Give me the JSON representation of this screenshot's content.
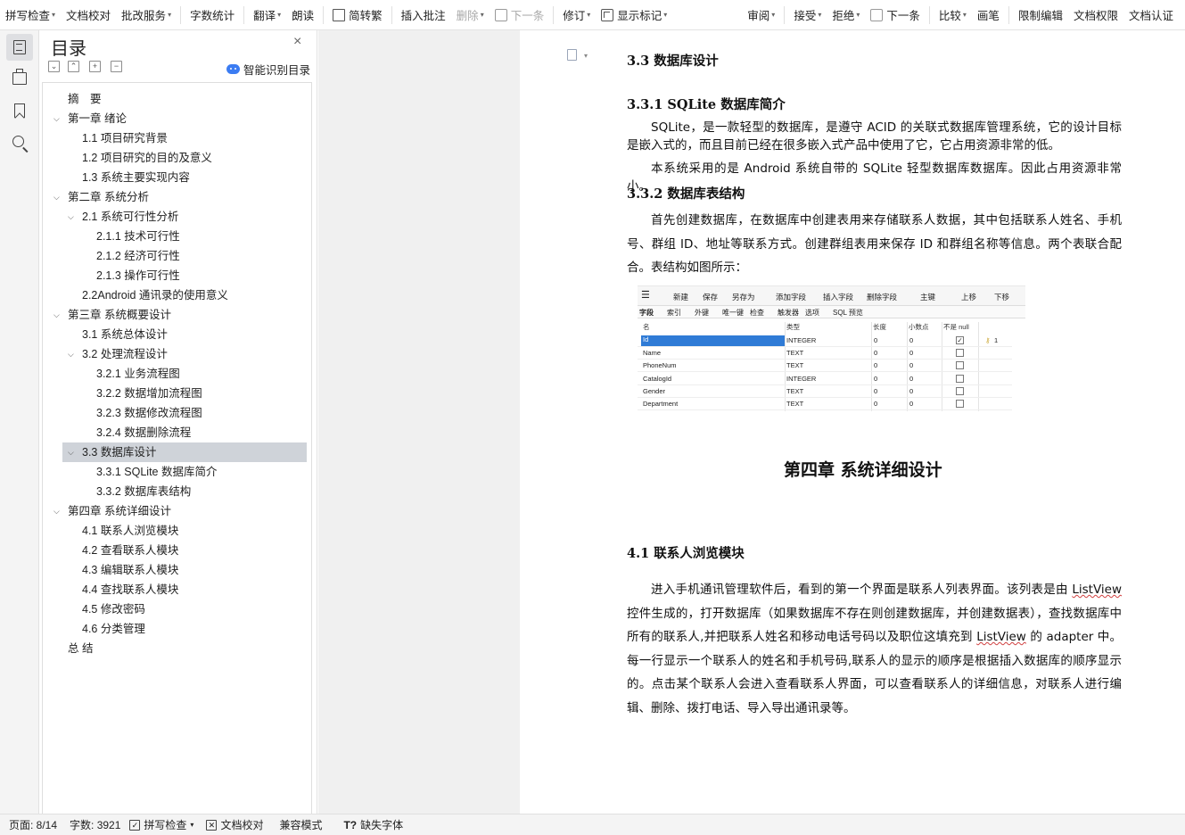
{
  "toolbar": {
    "items": [
      {
        "label": "拼写检查",
        "caret": true
      },
      {
        "label": "文档校对"
      },
      {
        "label": "批改服务",
        "caret": true
      },
      {
        "label": "字数统计"
      },
      {
        "label": "翻译",
        "caret": true
      },
      {
        "label": "朗读"
      },
      {
        "label": "简转繁"
      },
      {
        "label": "插入批注"
      },
      {
        "label": "删除",
        "caret": true,
        "disabled": true
      },
      {
        "label": "下一条",
        "disabled": true
      },
      {
        "label": "修订",
        "caret": true
      },
      {
        "label": "显示标记",
        "caret": true
      },
      {
        "label": "审阅",
        "caret": true
      },
      {
        "label": "接受",
        "caret": true
      },
      {
        "label": "拒绝",
        "caret": true
      },
      {
        "label": "下一条"
      },
      {
        "label": "比较",
        "caret": true
      },
      {
        "label": "画笔"
      },
      {
        "label": "限制编辑"
      },
      {
        "label": "文档权限"
      },
      {
        "label": "文档认证"
      }
    ]
  },
  "rail": {
    "buttons": [
      "toc-icon",
      "navigation-tree-icon",
      "bookmark-icon",
      "search-icon"
    ]
  },
  "toc": {
    "title": "目录",
    "close": "×",
    "controls": [
      "⌄",
      "⌃",
      "+",
      "−"
    ],
    "smart_label": "智能识别目录",
    "items": [
      {
        "text": "摘　要",
        "level": 0,
        "toggle": ""
      },
      {
        "text": "第一章  绪论",
        "level": 0,
        "toggle": "v"
      },
      {
        "text": "1.1 项目研究背景",
        "level": 1,
        "toggle": ""
      },
      {
        "text": "1.2 项目研究的目的及意义",
        "level": 1,
        "toggle": ""
      },
      {
        "text": "1.3 系统主要实现内容",
        "level": 1,
        "toggle": ""
      },
      {
        "text": "第二章  系统分析",
        "level": 0,
        "toggle": "v"
      },
      {
        "text": "2.1 系统可行性分析",
        "level": 1,
        "toggle": "v"
      },
      {
        "text": "2.1.1 技术可行性",
        "level": 2,
        "toggle": ""
      },
      {
        "text": "2.1.2 经济可行性",
        "level": 2,
        "toggle": ""
      },
      {
        "text": "2.1.3 操作可行性",
        "level": 2,
        "toggle": ""
      },
      {
        "text": "2.2Android 通讯录的使用意义",
        "level": 1,
        "toggle": ""
      },
      {
        "text": "第三章  系统概要设计",
        "level": 0,
        "toggle": "v"
      },
      {
        "text": "3.1 系统总体设计",
        "level": 1,
        "toggle": ""
      },
      {
        "text": "3.2 处理流程设计",
        "level": 1,
        "toggle": "v"
      },
      {
        "text": "3.2.1 业务流程图",
        "level": 2,
        "toggle": ""
      },
      {
        "text": "3.2.2 数据增加流程图",
        "level": 2,
        "toggle": ""
      },
      {
        "text": "3.2.3 数据修改流程图",
        "level": 2,
        "toggle": ""
      },
      {
        "text": "3.2.4 数据删除流程",
        "level": 2,
        "toggle": ""
      },
      {
        "text": "3.3  数据库设计",
        "level": 1,
        "toggle": "v",
        "selected": true
      },
      {
        "text": "3.3.1 SQLite 数据库简介",
        "level": 2,
        "toggle": ""
      },
      {
        "text": "3.3.2  数据库表结构",
        "level": 2,
        "toggle": ""
      },
      {
        "text": "第四章  系统详细设计",
        "level": 0,
        "toggle": "v"
      },
      {
        "text": "4.1 联系人浏览模块",
        "level": 1,
        "toggle": ""
      },
      {
        "text": "4.2 查看联系人模块",
        "level": 1,
        "toggle": ""
      },
      {
        "text": "4.3 编辑联系人模块",
        "level": 1,
        "toggle": ""
      },
      {
        "text": "4.4 查找联系人模块",
        "level": 1,
        "toggle": ""
      },
      {
        "text": "4.5 修改密码",
        "level": 1,
        "toggle": ""
      },
      {
        "text": "4.6 分类管理",
        "level": 1,
        "toggle": ""
      },
      {
        "text": "总  结",
        "level": 0,
        "toggle": ""
      }
    ]
  },
  "document": {
    "h_33": "3.3  数据库设计",
    "h_331": "3.3.1 SQLite 数据库简介",
    "p_sqlite_1": "SQLite，是一款轻型的数据库，是遵守 ACID 的关联式数据库管理系统，它的设计目标是嵌入式的，而且目前已经在很多嵌入式产品中使用了它，它占用资源非常的低。",
    "p_sqlite_2": "本系统采用的是 Android 系统自带的 SQLite 轻型数据库数据库。因此占用资源非常小。",
    "h_332": "3.3.2  数据库表结构",
    "p_table": "首先创建数据库，在数据库中创建表用来存储联系人数据，其中包括联系人姓名、手机号、群组 ID、地址等联系方式。创建群组表用来保存 ID 和群组名称等信息。两个表联合配合。表结构如图所示：",
    "chapter4": "第四章  系统详细设计",
    "h_41": "4.1 联系人浏览模块",
    "p_41_a": "进入手机通讯管理软件后，看到的第一个界面是联系人列表界面。该列表是由 ",
    "p_41_lv1": "ListView",
    "p_41_b": " 控件生成的，打开数据库（如果数据库不存在则创建数据库，并创建数据表），查找数据库中所有的联系人,并把联系人姓名和移动电话号码以及职位这填充到 ",
    "p_41_lv2": "ListView",
    "p_41_c": " 的 adapter 中。每一行显示一个联系人的姓名和手机号码,联系人的显示的顺序是根据插入数据库的顺序显示的。点击某个联系人会进入查看联系人界面，可以查看联系人的详细信息，对联系人进行编辑、删除、拨打电话、导入导出通讯录等。"
  },
  "designer": {
    "toolbar": [
      "☰",
      "新建",
      "保存",
      "另存为",
      "添加字段",
      "插入字段",
      "删除字段",
      "主键",
      "上移",
      "下移"
    ],
    "tabs": [
      "字段",
      "索引",
      "外键",
      "唯一键",
      "检查",
      "触发器",
      "选项",
      "SQL 预览"
    ],
    "columns": [
      "名",
      "类型",
      "长度",
      "小数点",
      "不是 null"
    ],
    "rows": [
      {
        "name": "Id",
        "type": "INTEGER",
        "length": "0",
        "decimals": "0",
        "notnull": true,
        "key": "1"
      },
      {
        "name": "Name",
        "type": "TEXT",
        "length": "0",
        "decimals": "0",
        "notnull": false,
        "key": ""
      },
      {
        "name": "PhoneNum",
        "type": "TEXT",
        "length": "0",
        "decimals": "0",
        "notnull": false,
        "key": ""
      },
      {
        "name": "CatalogId",
        "type": "INTEGER",
        "length": "0",
        "decimals": "0",
        "notnull": false,
        "key": ""
      },
      {
        "name": "Gender",
        "type": "TEXT",
        "length": "0",
        "decimals": "0",
        "notnull": false,
        "key": ""
      },
      {
        "name": "Department",
        "type": "TEXT",
        "length": "0",
        "decimals": "0",
        "notnull": false,
        "key": ""
      }
    ]
  },
  "status": {
    "page": "页面: 8/14",
    "words": "字数: 3921",
    "spell": "拼写检查",
    "proof": "文档校对",
    "compat": "兼容模式",
    "missing_font": "缺失字体"
  },
  "colors": {
    "selection": "#cfd3d9",
    "designer_selection": "#2f7bd6",
    "smart_icon": "#3b7cf2"
  }
}
